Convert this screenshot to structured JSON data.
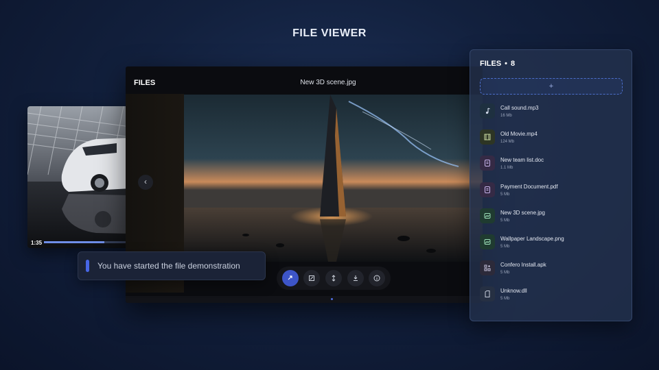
{
  "page": {
    "title": "FILE VIEWER"
  },
  "video": {
    "time": "1:35",
    "progress": 0.7
  },
  "viewer": {
    "brand": "FILES",
    "filename": "New 3D scene.jpg",
    "toolbar": [
      {
        "name": "share-icon",
        "active": true
      },
      {
        "name": "edit-icon",
        "active": false
      },
      {
        "name": "resize-icon",
        "active": false
      },
      {
        "name": "download-icon",
        "active": false
      },
      {
        "name": "info-icon",
        "active": false
      }
    ]
  },
  "toast": {
    "message": "You have started the file demonstration",
    "accent": "#4766e6"
  },
  "files": {
    "label": "FILES",
    "dot": "•",
    "count": "8",
    "upload_symbol": "+",
    "items": [
      {
        "name": "Call sound.mp3",
        "size": "16 Mb",
        "icon": "music-note-icon",
        "color": "#1e3040"
      },
      {
        "name": "Old Movie.mp4",
        "size": "124 Mb",
        "icon": "film-icon",
        "color": "#2d3524"
      },
      {
        "name": "New team list.doc",
        "size": "1.1 Mb",
        "icon": "document-icon",
        "color": "#352a45"
      },
      {
        "name": "Payment Document.pdf",
        "size": "5 Mb",
        "icon": "document-icon",
        "color": "#352a45"
      },
      {
        "name": "New 3D scene.jpg",
        "size": "5 Mb",
        "icon": "image-icon",
        "color": "#1f3b30"
      },
      {
        "name": "Wallpaper Landscape.png",
        "size": "5 Mb",
        "icon": "image-icon",
        "color": "#1f3b30"
      },
      {
        "name": "Confero Install.apk",
        "size": "5 Mb",
        "icon": "apps-icon",
        "color": "#2c2a3a"
      },
      {
        "name": "Unknow.dll",
        "size": "5 Mb",
        "icon": "blank-file-icon",
        "color": "#263043"
      }
    ]
  }
}
